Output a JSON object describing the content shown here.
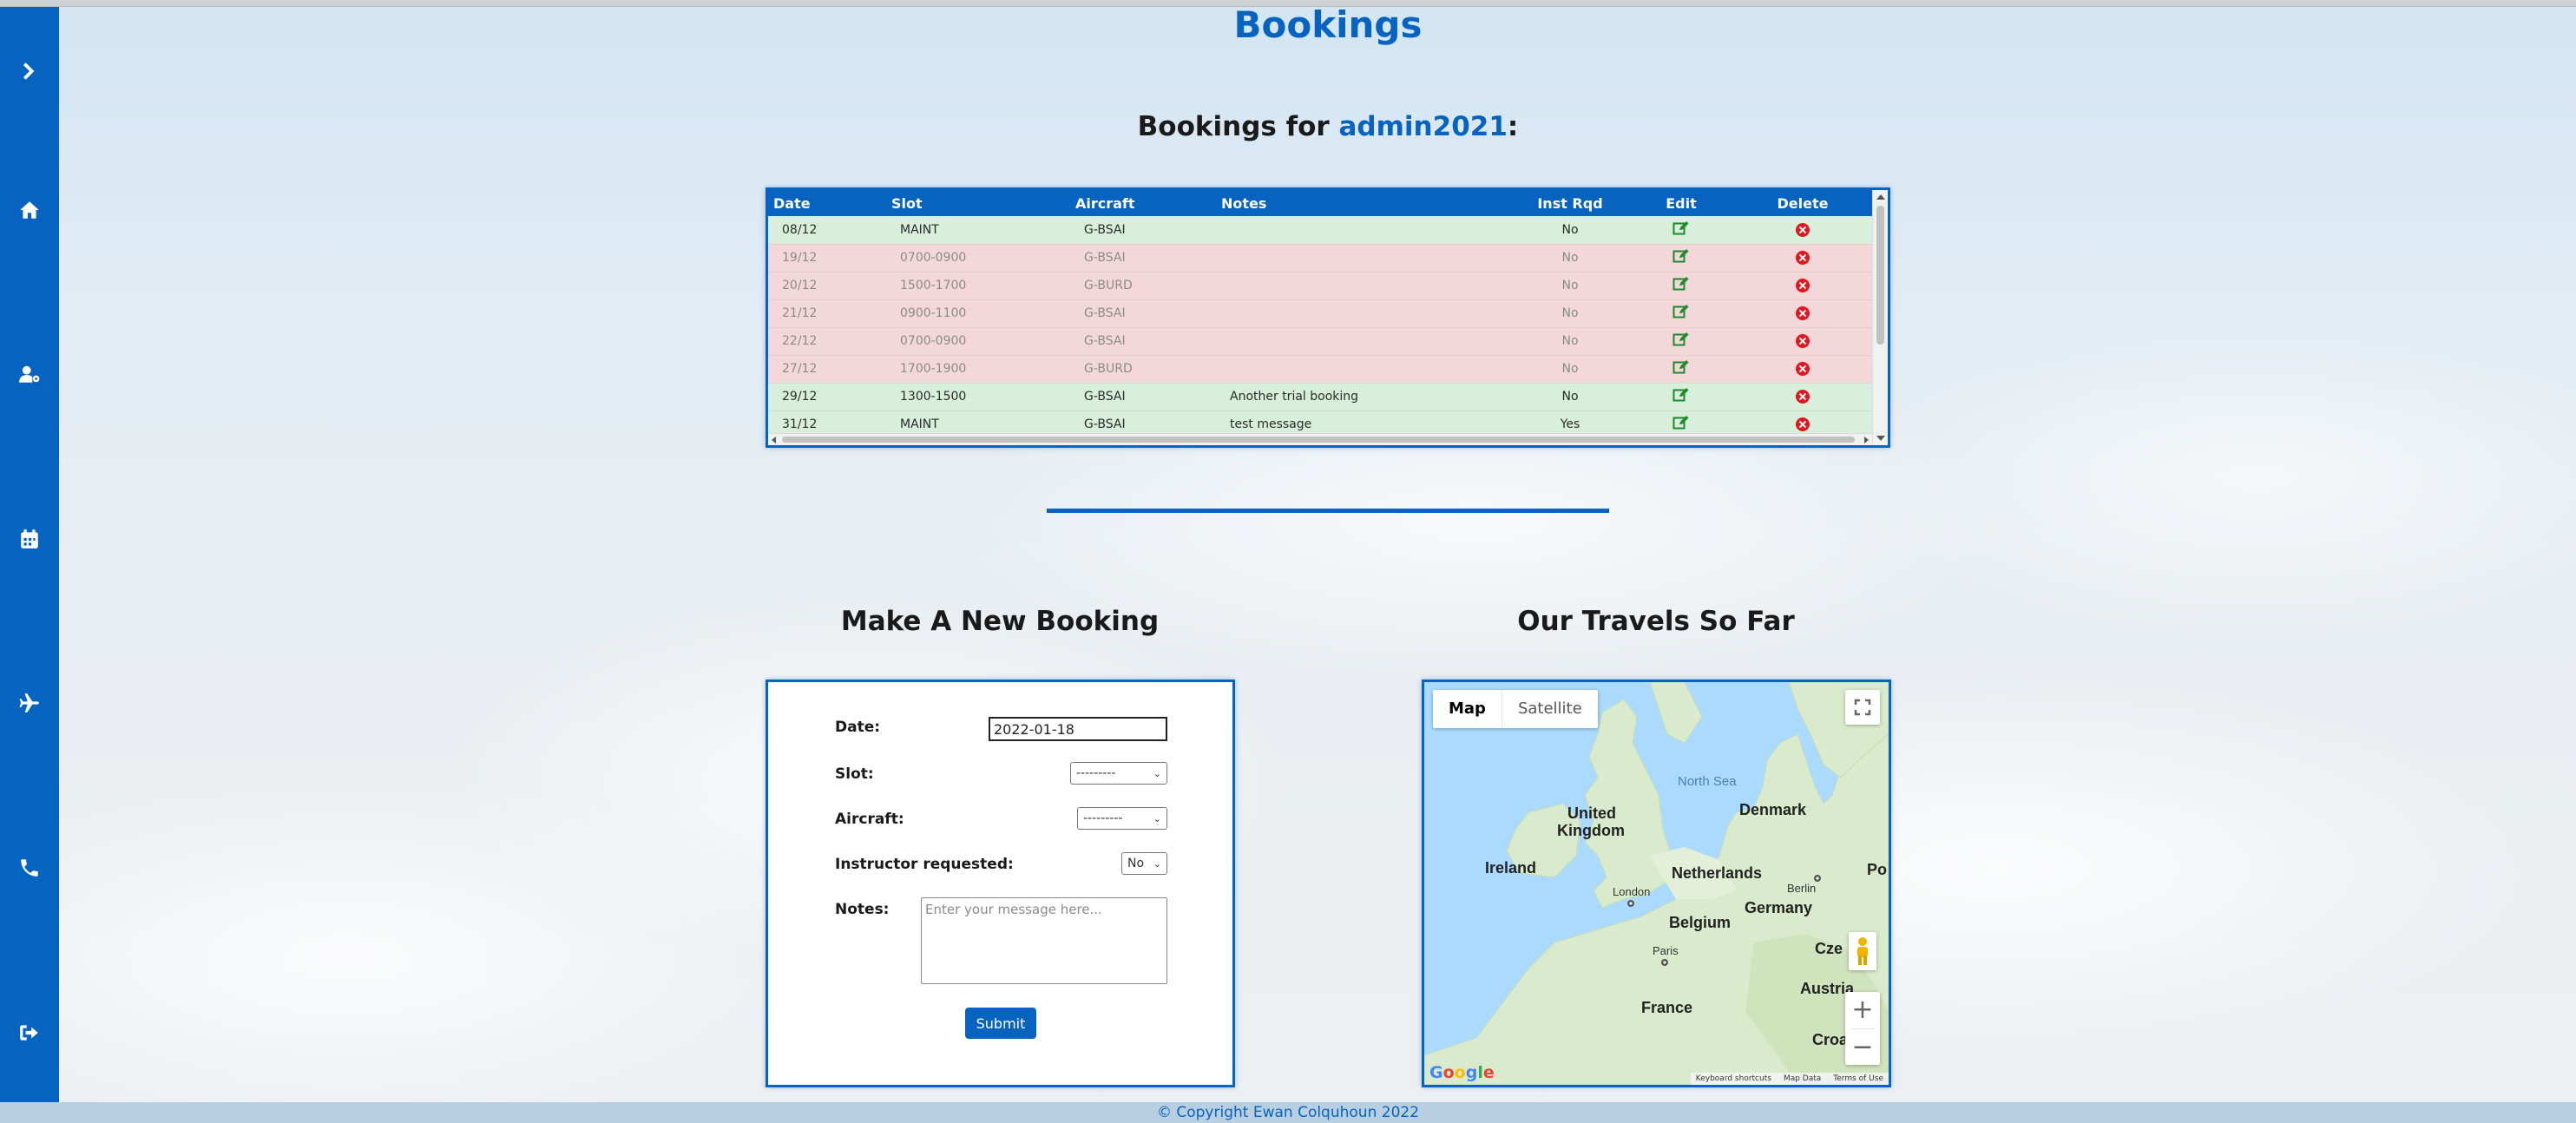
{
  "page": {
    "title": "Bookings"
  },
  "subheading": {
    "prefix": "Bookings for ",
    "username": "admin2021",
    "suffix": ":"
  },
  "sidebar": {
    "items": [
      {
        "icon": "chevron-right-icon"
      },
      {
        "icon": "home-icon"
      },
      {
        "icon": "user-settings-icon"
      },
      {
        "icon": "calendar-icon"
      },
      {
        "icon": "plane-icon"
      },
      {
        "icon": "phone-icon"
      },
      {
        "icon": "sign-out-icon"
      }
    ]
  },
  "bookings_table": {
    "headers": {
      "date": "Date",
      "slot": "Slot",
      "aircraft": "Aircraft",
      "notes": "Notes",
      "inst": "Inst Rqd",
      "edit": "Edit",
      "delete": "Delete"
    },
    "rows": [
      {
        "date": "08/12",
        "slot": "MAINT",
        "aircraft": "G-BSAI",
        "notes": "",
        "inst": "No",
        "status": "green"
      },
      {
        "date": "19/12",
        "slot": "0700-0900",
        "aircraft": "G-BSAI",
        "notes": "",
        "inst": "No",
        "status": "red"
      },
      {
        "date": "20/12",
        "slot": "1500-1700",
        "aircraft": "G-BURD",
        "notes": "",
        "inst": "No",
        "status": "red"
      },
      {
        "date": "21/12",
        "slot": "0900-1100",
        "aircraft": "G-BSAI",
        "notes": "",
        "inst": "No",
        "status": "red"
      },
      {
        "date": "22/12",
        "slot": "0700-0900",
        "aircraft": "G-BSAI",
        "notes": "",
        "inst": "No",
        "status": "red"
      },
      {
        "date": "27/12",
        "slot": "1700-1900",
        "aircraft": "G-BURD",
        "notes": "",
        "inst": "No",
        "status": "red"
      },
      {
        "date": "29/12",
        "slot": "1300-1500",
        "aircraft": "G-BSAI",
        "notes": "Another trial booking",
        "inst": "No",
        "status": "green"
      },
      {
        "date": "31/12",
        "slot": "MAINT",
        "aircraft": "G-BSAI",
        "notes": "test message",
        "inst": "Yes",
        "status": "green"
      }
    ]
  },
  "new_booking": {
    "title": "Make A New Booking",
    "date_label": "Date:",
    "date_value": "2022-01-18",
    "slot_label": "Slot:",
    "slot_value": "---------",
    "aircraft_label": "Aircraft:",
    "aircraft_value": "---------",
    "instructor_label": "Instructor requested:",
    "instructor_value": "No",
    "notes_label": "Notes:",
    "notes_placeholder": "Enter your message here...",
    "submit_label": "Submit"
  },
  "map": {
    "title": "Our Travels So Far",
    "type_map": "Map",
    "type_satellite": "Satellite",
    "labels": {
      "north_sea": "North Sea",
      "uk": "United",
      "uk2": "Kingdom",
      "ireland": "Ireland",
      "denmark": "Denmark",
      "netherlands": "Netherlands",
      "berlin": "Berlin",
      "london": "London",
      "germany": "Germany",
      "belgium": "Belgium",
      "paris": "Paris",
      "france": "France",
      "czech": "Cze",
      "austria": "Austria",
      "croatia": "Croa",
      "poland": "Po"
    },
    "logo": "Google",
    "footer": {
      "shortcuts": "Keyboard shortcuts",
      "data": "Map Data",
      "terms": "Terms of Use"
    },
    "colors": {
      "water": "#aadaff",
      "land": "#d9ebcc"
    }
  },
  "footer": {
    "copyright": "© Copyright Ewan Colquhoun 2022"
  },
  "colors": {
    "primary": "#0663c0",
    "row_ok": "#d8efdc",
    "row_past": "#f4d8d9",
    "delete": "#e4151f",
    "edit": "#1e8a2e"
  }
}
